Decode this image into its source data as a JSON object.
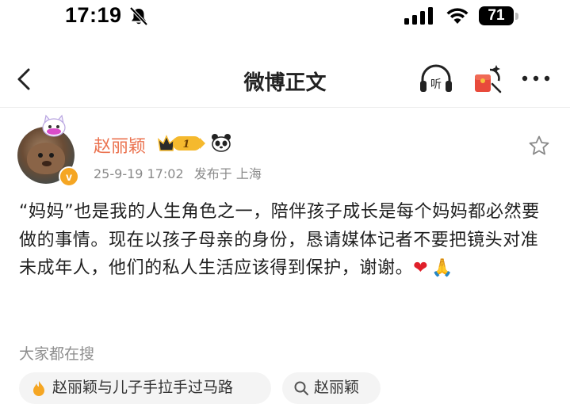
{
  "status_bar": {
    "time": "17:19",
    "battery": "71"
  },
  "nav": {
    "title": "微博正文"
  },
  "post": {
    "author": "赵丽颖",
    "vip_level": "1",
    "date": "25-9-19 17:02",
    "location": "发布于 上海",
    "text": "“妈妈”也是我的人生角色之一，陪伴孩子成长是每个妈妈都必然要做的事情。现在以孩子母亲的身份，恳请媒体记者不要把镜头对准未成年人，他们的私人生活应该得到保护，谢谢。",
    "emoji": [
      "❤",
      "🙏"
    ]
  },
  "trending": {
    "title": "大家都在搜",
    "items": [
      "赵丽颖与儿子手拉手过马路",
      "赵丽颖"
    ]
  },
  "colors": {
    "accent": "#eb7350",
    "vip_gold": "#f5b92e",
    "heart": "#e0202a",
    "redpack": "#e84a3b"
  },
  "icons": [
    "back-icon",
    "listen-icon",
    "red-packet-icon",
    "more-icon",
    "star-icon",
    "verified-icon",
    "search-icon",
    "bell-off-icon",
    "signal-icon",
    "wifi-icon",
    "battery-icon"
  ]
}
